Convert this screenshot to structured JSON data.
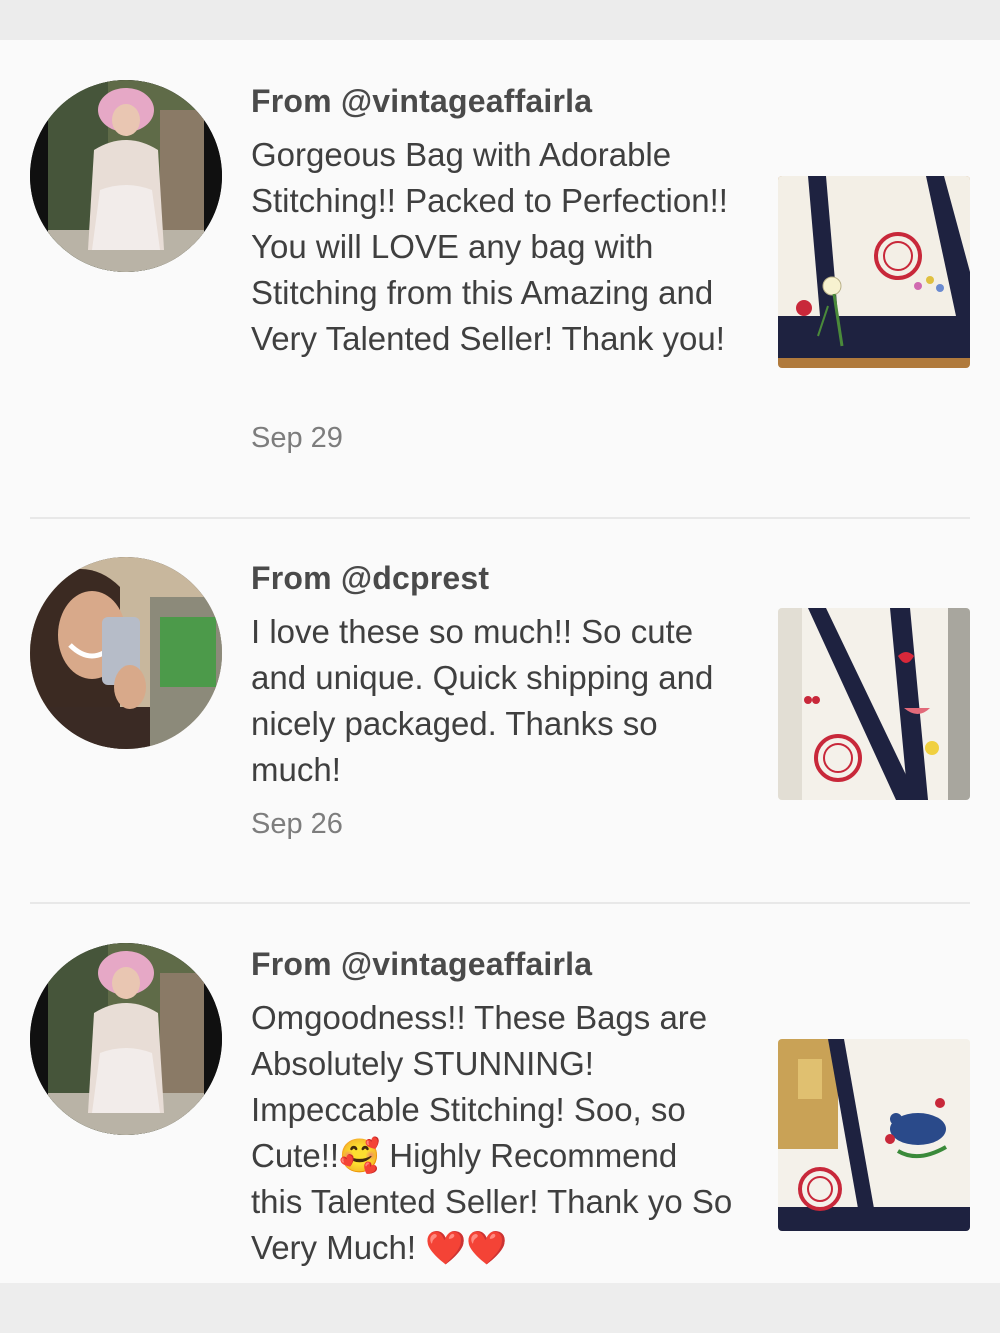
{
  "reviews": [
    {
      "from": "From @vintageaffairla",
      "text": "Gorgeous Bag with Adorable Stitching!! Packed to Perfection!! You will LOVE any bag with Stitching from this Amazing and Very Talented Seller! Thank you!",
      "date": "Sep 29"
    },
    {
      "from": "From @dcprest",
      "text": "I love these so much!! So cute and unique. Quick shipping and nicely packaged. Thanks so much!",
      "date": "Sep 26"
    },
    {
      "from": "From @vintageaffairla",
      "text": "Omgoodness!! These Bags are Absolutely STUNNING! Impeccable Stitching! Soo, so Cute!!🥰 Highly Recommend this Talented Seller! Thank yo So Very Much! ❤️❤️",
      "date": ""
    }
  ],
  "colors": {
    "bag_trim": "#1e2240",
    "stitch_red": "#c8283a",
    "background": "#fafafa"
  }
}
